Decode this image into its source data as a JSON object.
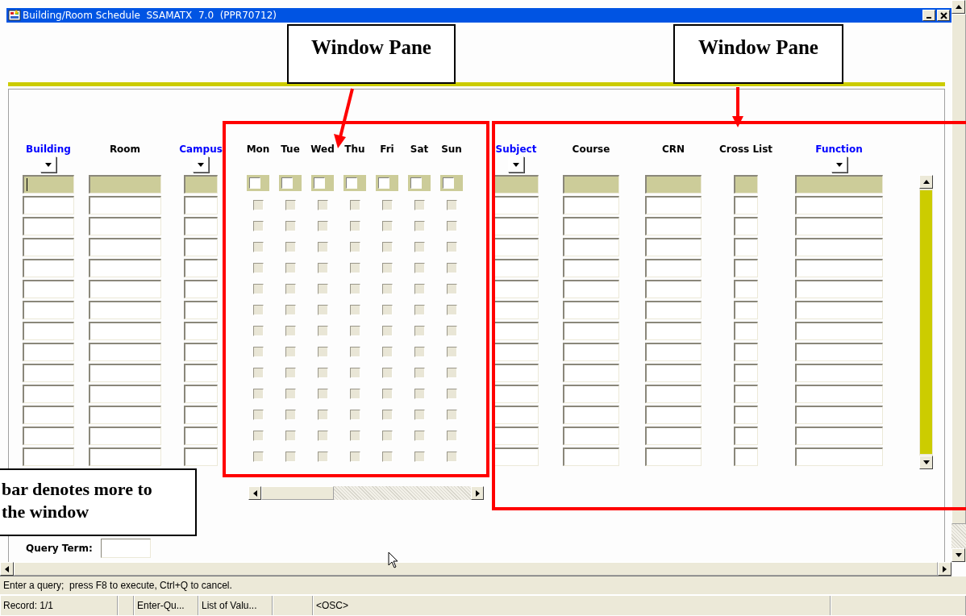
{
  "window": {
    "title": "Building/Room Schedule  SSAMATX  7.0  (PPR70712)"
  },
  "callouts": [
    {
      "lines": [
        "Window Pane"
      ]
    },
    {
      "lines": [
        "Window Pane"
      ]
    },
    {
      "lines": [
        "bar denotes more to",
        "the window"
      ]
    }
  ],
  "left_columns": [
    {
      "label": "Building",
      "lov": true
    },
    {
      "label": "Room",
      "lov": false
    },
    {
      "label": "Campus",
      "lov": true
    }
  ],
  "days": [
    "Mon",
    "Tue",
    "Wed",
    "Thu",
    "Fri",
    "Sat",
    "Sun"
  ],
  "right_columns": [
    {
      "label": "Subject",
      "lov": true
    },
    {
      "label": "Course",
      "lov": false
    },
    {
      "label": "CRN",
      "lov": false
    },
    {
      "label": "Cross List",
      "lov": false
    },
    {
      "label": "Function",
      "lov": true
    }
  ],
  "rows": [
    {
      "selected": true
    },
    {
      "selected": false
    },
    {
      "selected": false
    },
    {
      "selected": false
    },
    {
      "selected": false
    },
    {
      "selected": false
    },
    {
      "selected": false
    },
    {
      "selected": false
    },
    {
      "selected": false
    },
    {
      "selected": false
    },
    {
      "selected": false
    },
    {
      "selected": false
    },
    {
      "selected": false
    },
    {
      "selected": false
    }
  ],
  "query": {
    "label": "Query Term:"
  },
  "message": "Enter a query;  press F8 to execute, Ctrl+Q to cancel.",
  "status_bar": [
    "Record: 1/1",
    "Enter-Qu...",
    "List of Valu...",
    "<OSC>"
  ]
}
